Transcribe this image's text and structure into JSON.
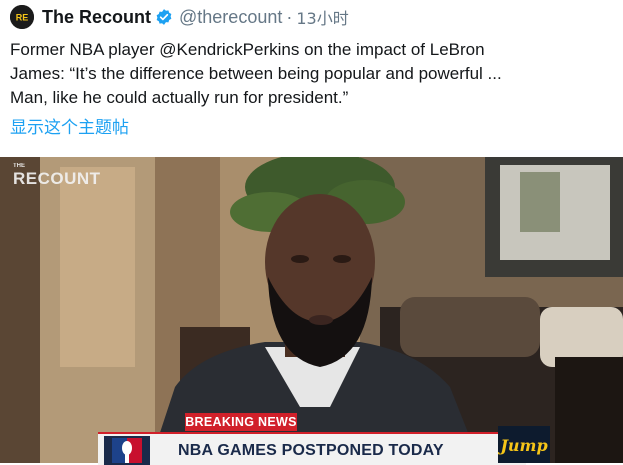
{
  "tweet": {
    "display_name": "The Recount",
    "avatar_letters": "RE",
    "handle": "@therecount",
    "separator": "·",
    "time": "13小时",
    "text_lines": [
      "Former NBA player @KendrickPerkins on the impact of LeBron",
      "James: “It’s the difference between being popular and powerful ...",
      "Man, like he could actually run for president.”"
    ],
    "translate_link": "显示这个主题帖"
  },
  "media": {
    "watermark_small": "THE",
    "watermark": "RECOUNT",
    "breaking_label": "BREAKING NEWS",
    "ticker_headline": "NBA GAMES POSTPONED TODAY",
    "show_logo": "Jump"
  },
  "colors": {
    "link": "#1da1f2",
    "verified": "#1da1f2",
    "breaking": "#d1202a",
    "secondary_text": "#657786"
  },
  "icons": {
    "verified": "verified-badge-icon",
    "league_logo": "nba-logo-icon"
  }
}
